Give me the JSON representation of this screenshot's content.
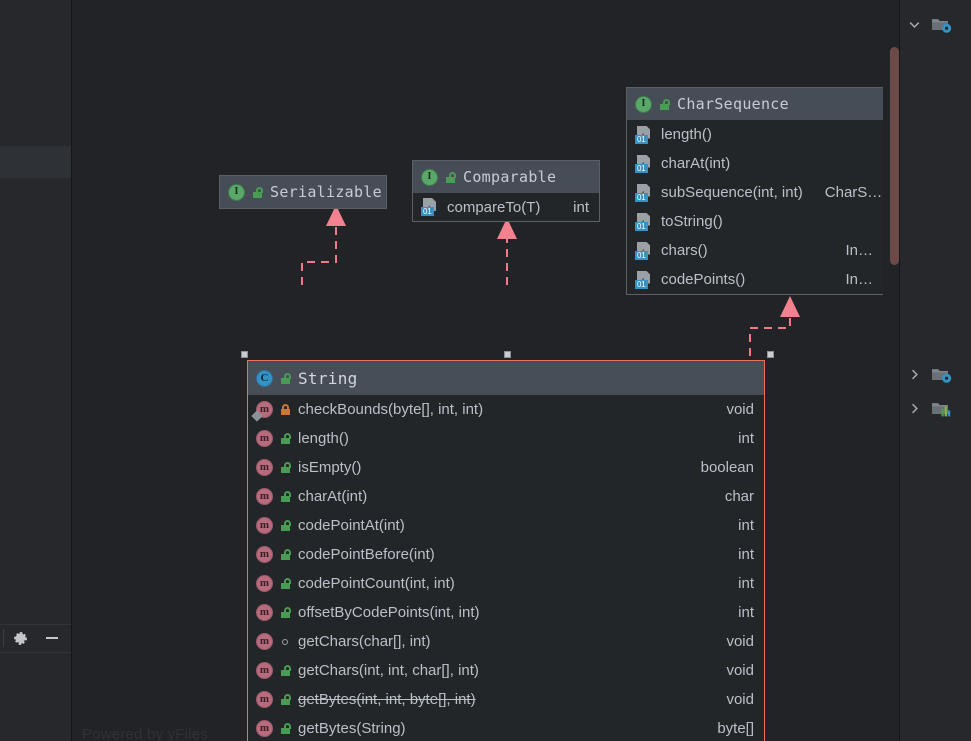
{
  "app": {
    "watermark": "Powered by yFiles"
  },
  "left_panel": {
    "toolbar": {
      "settings_label": "Settings",
      "settings_icon": "gear-icon",
      "collapse_label": "Hide",
      "collapse_icon": "minus-icon"
    }
  },
  "right_panel": {
    "items": [
      {
        "chevron": "chevron-down-icon",
        "icon": "folder-settings-icon",
        "state": "expanded"
      },
      {
        "chevron": "chevron-right-icon",
        "icon": "folder-settings-icon",
        "state": "collapsed"
      },
      {
        "chevron": "chevron-right-icon",
        "icon": "folder-chart-icon",
        "state": "collapsed"
      }
    ]
  },
  "diagram": {
    "nodes": [
      {
        "id": "serializable",
        "name": "Serializable",
        "kind": "interface",
        "kind_icon": "interface-icon",
        "visibility_icon": "lock-open-icon",
        "selected": false,
        "members": []
      },
      {
        "id": "comparable",
        "name": "Comparable",
        "kind": "interface",
        "kind_icon": "interface-icon",
        "visibility_icon": "lock-open-icon",
        "selected": false,
        "members": [
          {
            "icon": "abstract-method-icon",
            "name": "compareTo(T)",
            "type": "int",
            "visibility": "none",
            "deprecated": false
          }
        ]
      },
      {
        "id": "charsequence",
        "name": "CharSequence",
        "kind": "interface",
        "kind_icon": "interface-icon",
        "visibility_icon": "lock-open-icon",
        "selected": false,
        "members": [
          {
            "icon": "abstract-method-icon",
            "name": "length()",
            "type": "",
            "visibility": "none",
            "deprecated": false
          },
          {
            "icon": "abstract-method-icon",
            "name": "charAt(int)",
            "type": "",
            "visibility": "none",
            "deprecated": false
          },
          {
            "icon": "abstract-method-icon",
            "name": "subSequence(int, int)",
            "type": "CharS…",
            "visibility": "none",
            "deprecated": false
          },
          {
            "icon": "abstract-method-icon",
            "name": "toString()",
            "type": "",
            "visibility": "none",
            "deprecated": false
          },
          {
            "icon": "abstract-method-icon",
            "name": "chars()",
            "type": "In…",
            "visibility": "none",
            "deprecated": false
          },
          {
            "icon": "abstract-method-icon",
            "name": "codePoints()",
            "type": "In…",
            "visibility": "none",
            "deprecated": false
          }
        ]
      },
      {
        "id": "string",
        "name": "String",
        "kind": "class",
        "kind_icon": "class-icon",
        "visibility_icon": "lock-open-icon",
        "selected": true,
        "members": [
          {
            "icon": "method-icon",
            "name": "checkBounds(byte[], int, int)",
            "type": "void",
            "visibility": "private",
            "static": true,
            "deprecated": false
          },
          {
            "icon": "method-icon",
            "name": "length()",
            "type": "int",
            "visibility": "public",
            "deprecated": false
          },
          {
            "icon": "method-icon",
            "name": "isEmpty()",
            "type": "boolean",
            "visibility": "public",
            "deprecated": false
          },
          {
            "icon": "method-icon",
            "name": "charAt(int)",
            "type": "char",
            "visibility": "public",
            "deprecated": false
          },
          {
            "icon": "method-icon",
            "name": "codePointAt(int)",
            "type": "int",
            "visibility": "public",
            "deprecated": false
          },
          {
            "icon": "method-icon",
            "name": "codePointBefore(int)",
            "type": "int",
            "visibility": "public",
            "deprecated": false
          },
          {
            "icon": "method-icon",
            "name": "codePointCount(int, int)",
            "type": "int",
            "visibility": "public",
            "deprecated": false
          },
          {
            "icon": "method-icon",
            "name": "offsetByCodePoints(int, int)",
            "type": "int",
            "visibility": "public",
            "deprecated": false
          },
          {
            "icon": "method-icon",
            "name": "getChars(char[], int)",
            "type": "void",
            "visibility": "package",
            "deprecated": false
          },
          {
            "icon": "method-icon",
            "name": "getChars(int, int, char[], int)",
            "type": "void",
            "visibility": "public",
            "deprecated": false
          },
          {
            "icon": "method-icon",
            "name": "getBytes(int, int, byte[], int)",
            "type": "void",
            "visibility": "public",
            "deprecated": true
          },
          {
            "icon": "method-icon",
            "name": "getBytes(String)",
            "type": "byte[]",
            "visibility": "public",
            "deprecated": false
          }
        ]
      }
    ],
    "edges": [
      {
        "from": "string",
        "to": "serializable",
        "style": "dashed",
        "arrow": "hollow-triangle",
        "color": "#e8798a"
      },
      {
        "from": "string",
        "to": "comparable",
        "style": "dashed",
        "arrow": "hollow-triangle",
        "color": "#e8798a"
      },
      {
        "from": "string",
        "to": "charsequence",
        "style": "dashed",
        "arrow": "hollow-triangle",
        "color": "#e8798a"
      }
    ],
    "colors": {
      "selection_border": "#e8705f",
      "edge": "#ef7a88",
      "header_bg": "#464d57",
      "body_bg": "#232629",
      "canvas_bg": "#212326"
    }
  }
}
